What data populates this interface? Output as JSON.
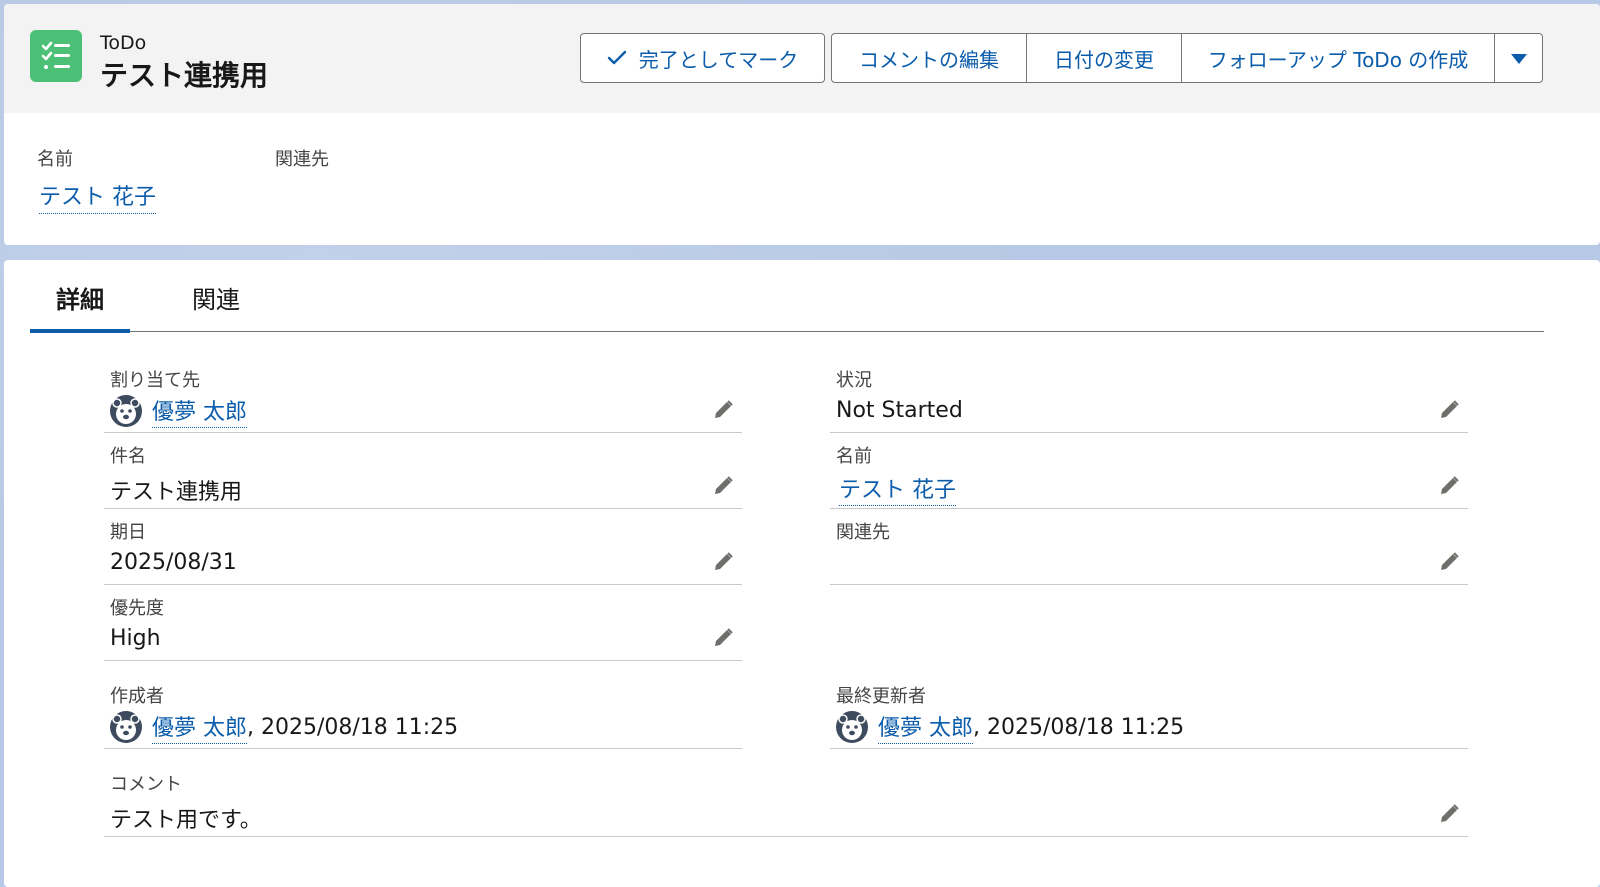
{
  "header": {
    "object_type": "ToDo",
    "title": "テスト連携用",
    "buttons": {
      "mark_complete": "完了としてマーク",
      "edit_comment": "コメントの編集",
      "change_date": "日付の変更",
      "create_followup": "フォローアップ ToDo の作成"
    },
    "highlights": {
      "name_label": "名前",
      "name_value": "テスト 花子",
      "related_label": "関連先"
    }
  },
  "tabs": {
    "detail": "詳細",
    "related": "関連"
  },
  "fields": {
    "assigned_label": "割り当て先",
    "assigned_value": "優夢 太郎",
    "status_label": "状況",
    "status_value": "Not Started",
    "subject_label": "件名",
    "subject_value": "テスト連携用",
    "name_label": "名前",
    "name_value": "テスト 花子",
    "due_label": "期日",
    "due_value": "2025/08/31",
    "related_label": "関連先",
    "priority_label": "優先度",
    "priority_value": "High",
    "created_label": "作成者",
    "created_user": "優夢 太郎",
    "created_date": ", 2025/08/18 11:25",
    "modified_label": "最終更新者",
    "modified_user": "優夢 太郎",
    "modified_date": ", 2025/08/18 11:25",
    "comment_label": "コメント",
    "comment_value": "テスト用です。"
  },
  "colors": {
    "brand_link": "#0b5cab",
    "task_icon": "#4bc076"
  }
}
